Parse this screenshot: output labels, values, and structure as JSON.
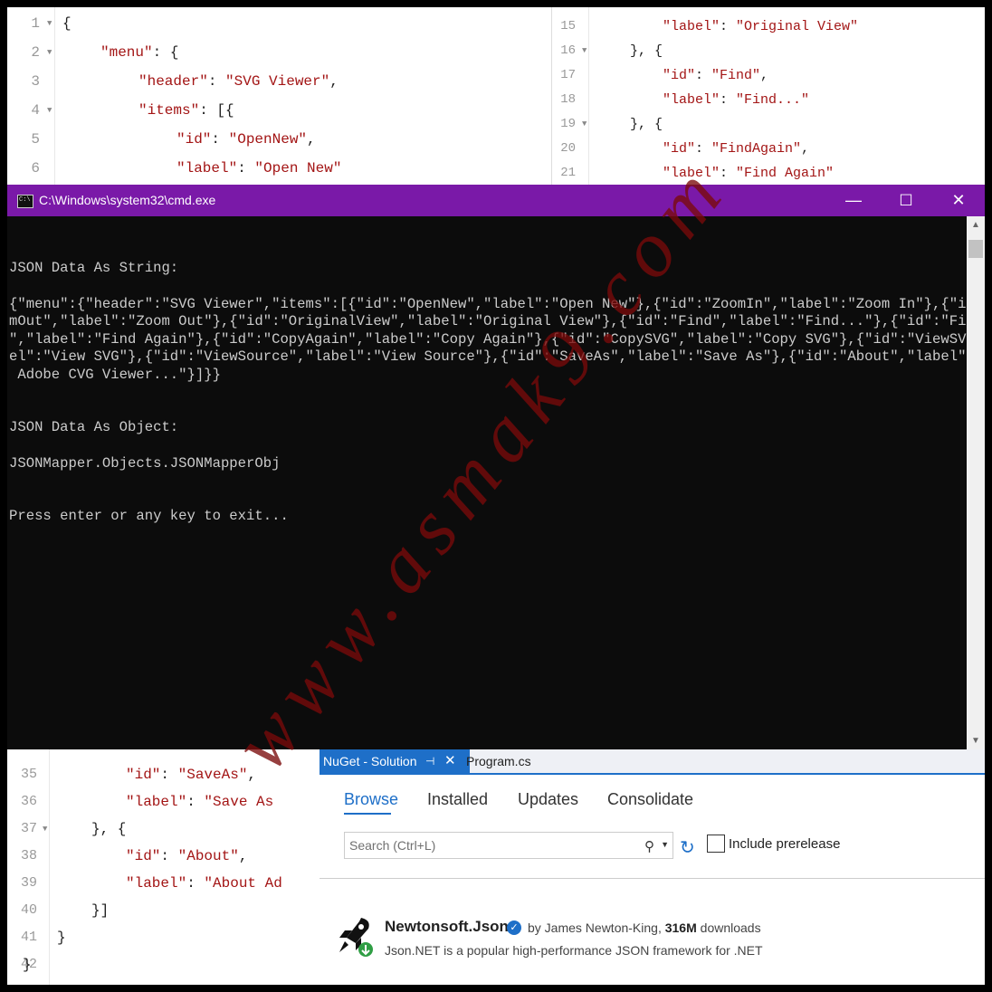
{
  "editor_top_left": {
    "lines": [
      {
        "n": "1",
        "fold": true,
        "indent": 0,
        "text": "{"
      },
      {
        "n": "2",
        "fold": true,
        "indent": 1,
        "key": "\"menu\"",
        "rest": ": {"
      },
      {
        "n": "3",
        "fold": false,
        "indent": 2,
        "key": "\"header\"",
        "rest": ": ",
        "str": "\"SVG Viewer\"",
        "tail": ","
      },
      {
        "n": "4",
        "fold": true,
        "indent": 2,
        "key": "\"items\"",
        "rest": ": [{"
      },
      {
        "n": "5",
        "fold": false,
        "indent": 3,
        "key": "\"id\"",
        "rest": ": ",
        "str": "\"OpenNew\"",
        "tail": ","
      },
      {
        "n": "6",
        "fold": false,
        "indent": 3,
        "key": "\"label\"",
        "rest": ": ",
        "str": "\"Open New\"",
        "tail": ""
      }
    ]
  },
  "editor_top_right": {
    "lines": [
      {
        "n": "15",
        "fold": false,
        "indent": 3,
        "key": "\"label\"",
        "rest": ": ",
        "str": "\"Original View\"",
        "tail": ""
      },
      {
        "n": "16",
        "fold": true,
        "indent": 2,
        "text": "}, {"
      },
      {
        "n": "17",
        "fold": false,
        "indent": 3,
        "key": "\"id\"",
        "rest": ": ",
        "str": "\"Find\"",
        "tail": ","
      },
      {
        "n": "18",
        "fold": false,
        "indent": 3,
        "key": "\"label\"",
        "rest": ": ",
        "str": "\"Find...\"",
        "tail": ""
      },
      {
        "n": "19",
        "fold": true,
        "indent": 2,
        "text": "}, {"
      },
      {
        "n": "20",
        "fold": false,
        "indent": 3,
        "key": "\"id\"",
        "rest": ": ",
        "str": "\"FindAgain\"",
        "tail": ","
      },
      {
        "n": "21",
        "fold": false,
        "indent": 3,
        "key": "\"label\"",
        "rest": ": ",
        "str": "\"Find Again\"",
        "tail": ""
      }
    ]
  },
  "editor_bottom_left": {
    "lines": [
      {
        "n": "35",
        "fold": false,
        "indent": 3,
        "key": "\"id\"",
        "rest": ": ",
        "str": "\"SaveAs\"",
        "tail": ","
      },
      {
        "n": "36",
        "fold": false,
        "indent": 3,
        "key": "\"label\"",
        "rest": ": ",
        "str": "\"Save As",
        "tail": ""
      },
      {
        "n": "37",
        "fold": true,
        "indent": 2,
        "text": "}, {"
      },
      {
        "n": "38",
        "fold": false,
        "indent": 3,
        "key": "\"id\"",
        "rest": ": ",
        "str": "\"About\"",
        "tail": ","
      },
      {
        "n": "39",
        "fold": false,
        "indent": 3,
        "key": "\"label\"",
        "rest": ": ",
        "str": "\"About Ad",
        "tail": ""
      },
      {
        "n": "40",
        "fold": false,
        "indent": 2,
        "text": "}]"
      },
      {
        "n": "41",
        "fold": false,
        "indent": 1,
        "text": "}"
      },
      {
        "n": "42",
        "fold": false,
        "indent": 0,
        "text": "}"
      }
    ]
  },
  "cmd": {
    "title": "C:\\Windows\\system32\\cmd.exe",
    "icon_text": "C:\\",
    "minimize": "—",
    "maximize": "☐",
    "close": "✕",
    "lines": [
      "JSON Data As String:",
      "{\"menu\":{\"header\":\"SVG Viewer\",\"items\":[{\"id\":\"OpenNew\",\"label\":\"Open New\"},{\"id\":\"ZoomIn\",\"label\":\"Zoom In\"},{\"id\":\"Zoo",
      "mOut\",\"label\":\"Zoom Out\"},{\"id\":\"OriginalView\",\"label\":\"Original View\"},{\"id\":\"Find\",\"label\":\"Find...\"},{\"id\":\"FindAgain",
      "\",\"label\":\"Find Again\"},{\"id\":\"CopyAgain\",\"label\":\"Copy Again\"},{\"id\":\"CopySVG\",\"label\":\"Copy SVG\"},{\"id\":\"ViewSVG\",\"lab",
      "el\":\"View SVG\"},{\"id\":\"ViewSource\",\"label\":\"View Source\"},{\"id\":\"SaveAs\",\"label\":\"Save As\"},{\"id\":\"About\",\"label\":\"About",
      " Adobe CVG Viewer...\"}]}}",
      "JSON Data As Object:",
      "JSONMapper.Objects.JSONMapperObj",
      "Press enter or any key to exit..."
    ]
  },
  "watermark": "www.asmak9.com",
  "nuget": {
    "tab_label": "NuGet - Solution",
    "tab_pin": "⊣",
    "tab_close": "✕",
    "other_tab": "Program.cs",
    "nav": [
      "Browse",
      "Installed",
      "Updates",
      "Consolidate"
    ],
    "search_placeholder": "Search (Ctrl+L)",
    "prerelease_label": "Include prerelease",
    "package": {
      "name": "Newtonsoft.Json",
      "by_prefix": "by James Newton-King, ",
      "downloads": "316M",
      "downloads_suffix": " downloads",
      "description": "Json.NET is a popular high-performance JSON framework for .NET"
    }
  }
}
